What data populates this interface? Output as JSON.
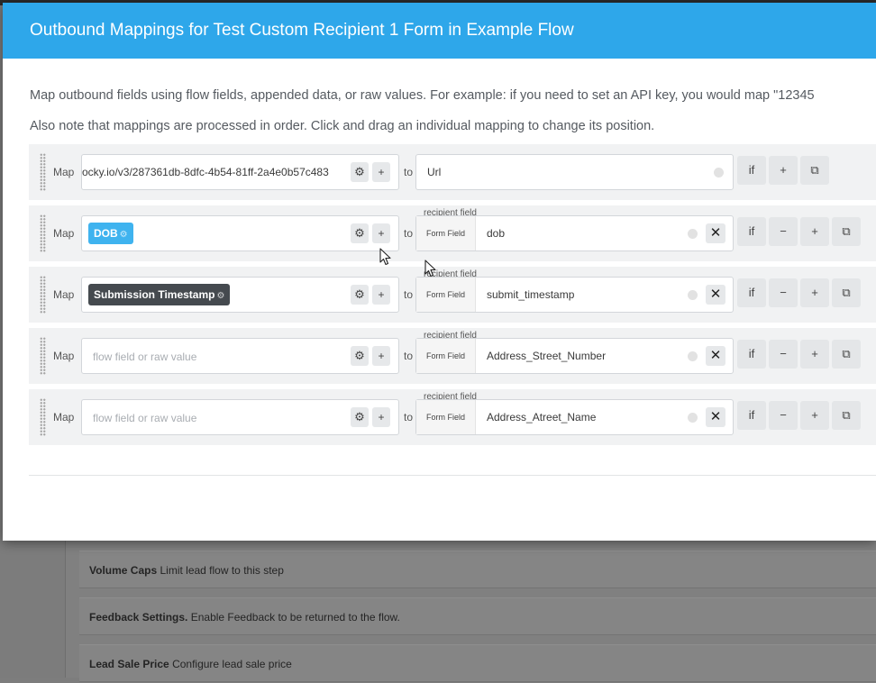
{
  "modal": {
    "title": "Outbound Mappings for Test Custom Recipient 1 Form in Example Flow",
    "intro_line1": "Map outbound fields using flow fields, appended data, or raw values. For example: if you need to set an API key, you would map \"12345",
    "intro_line2": "Also note that mappings are processed in order. Click and drag an individual mapping to change its position."
  },
  "labels": {
    "map": "Map",
    "to": "to",
    "recipient_field": "recipient field",
    "form_field": "Form Field",
    "if": "if",
    "plus": "+",
    "minus": "−",
    "gear": "⚙",
    "x": "✕",
    "copy": "⧉",
    "placeholder": "flow field or raw value"
  },
  "mappings": [
    {
      "source": "ocky.io/v3/287361db-8dfc-4b54-81ff-2a4e0b57c483",
      "dest": "Url"
    },
    {
      "source_chip": "DOB",
      "dest": "dob"
    },
    {
      "source_chip": "Submission Timestamp",
      "dest": "submit_timestamp"
    },
    {
      "source": "",
      "dest": "Address_Street_Number"
    },
    {
      "source": "",
      "dest": "Address_Atreet_Name"
    }
  ],
  "background": {
    "volume_caps_title": "Volume Caps",
    "volume_caps_desc": "Limit lead flow to this step",
    "feedback_title": "Feedback Settings.",
    "feedback_desc": "Enable Feedback to be returned to the flow.",
    "lead_price_title": "Lead Sale Price",
    "lead_price_desc": "Configure lead sale price"
  },
  "colors": {
    "header": "#2ea7ea",
    "chip_blue": "#3fb3ef",
    "chip_dark": "#454a4f"
  },
  "icons": [
    "drag-handle-icon",
    "gear-icon",
    "plus-icon",
    "minus-icon",
    "close-icon",
    "copy-icon",
    "status-dot-icon",
    "mouse-cursor-icon"
  ]
}
